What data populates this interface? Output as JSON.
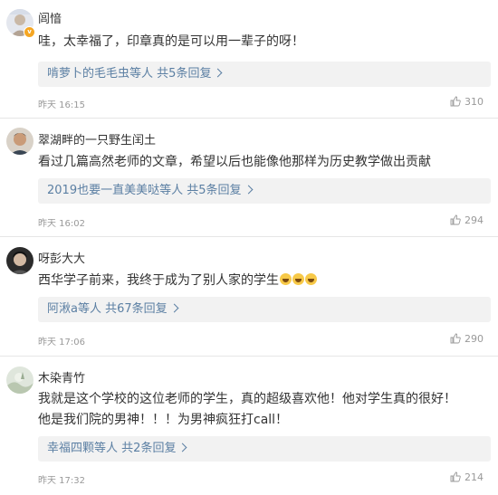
{
  "comments": [
    {
      "username": "闾愔",
      "content_lines": [
        "哇，太幸福了，印章真的是可以用一辈子的呀！"
      ],
      "reply_names": "啃萝卜的毛毛虫",
      "reply_suffix": "等人",
      "reply_count": "共5条回复",
      "time": "昨天 16:15",
      "likes": "310",
      "verified": true
    },
    {
      "username": "翠湖畔的一只野生闰土",
      "content_lines": [
        "看过几篇高然老师的文章，希望以后也能像他那样为历史教学做出贡献"
      ],
      "reply_names": "2019也要一直美美哒",
      "reply_suffix": "等人",
      "reply_count": "共5条回复",
      "time": "昨天 16:02",
      "likes": "294"
    },
    {
      "username": "呀彭大大",
      "content_lines": [
        "西华学子前来，我终于成为了别人家的学生"
      ],
      "reply_names": "阿湫a",
      "reply_suffix": "等人",
      "reply_count": "共67条回复",
      "time": "昨天 17:06",
      "likes": "290"
    },
    {
      "username": "木染青竹",
      "content_lines": [
        "我就是这个学校的这位老师的学生，真的超级喜欢他！他对学生真的很好！",
        "他是我们院的男神！！！为男神疯狂打call！"
      ],
      "reply_names": "幸福四颗",
      "reply_suffix": "等人",
      "reply_count": "共2条回复",
      "time": "昨天 17:32",
      "likes": "214"
    }
  ],
  "icons": {
    "like": "thumbs-up-icon",
    "verified": "verified-badge-icon",
    "emoji": "laughing-emoji-icon"
  },
  "colors": {
    "link": "#5b7fa3",
    "reply_bg": "#f2f2f2",
    "meta": "#999999",
    "badge": "#f5a623"
  }
}
